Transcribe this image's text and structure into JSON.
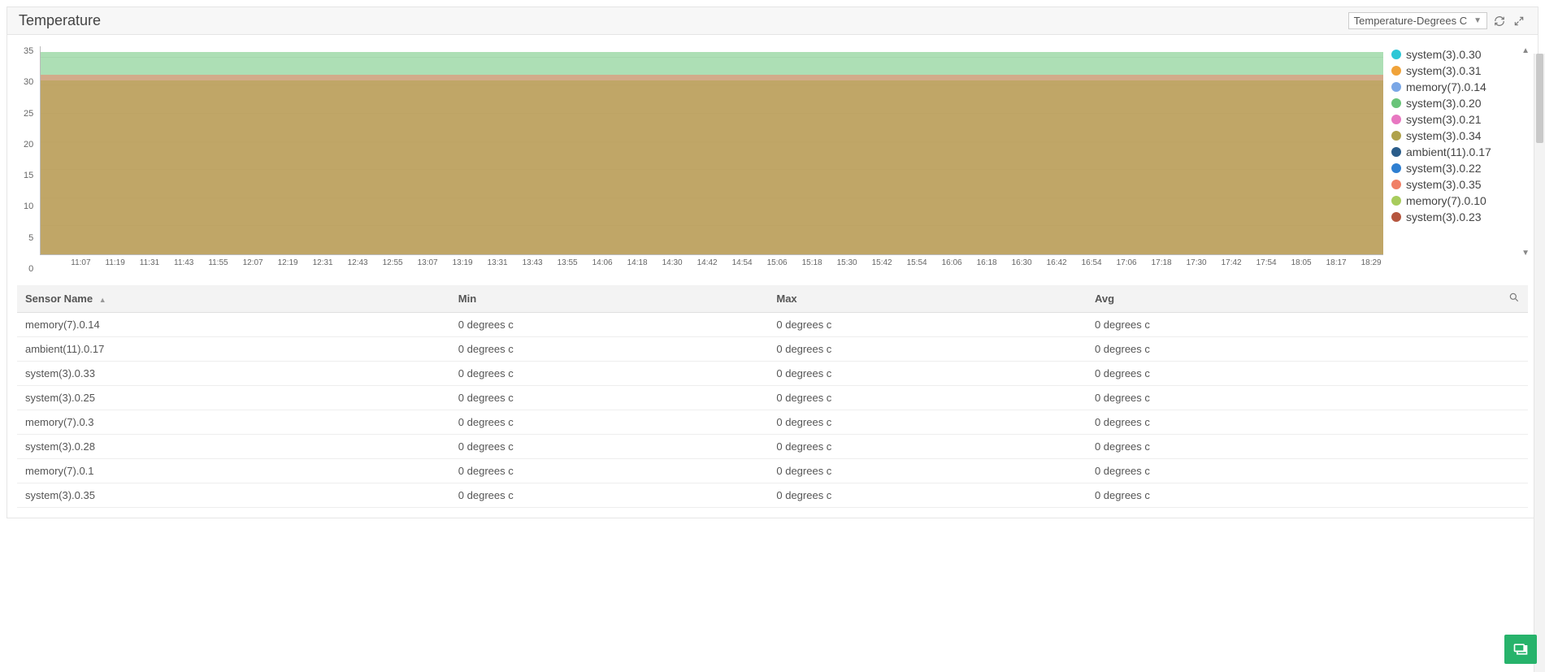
{
  "header": {
    "title": "Temperature",
    "dropdown_label": "Temperature-Degrees C"
  },
  "chart_data": {
    "type": "area",
    "ylabel": "",
    "xlabel": "",
    "ylim": [
      0,
      37
    ],
    "yticks": [
      0,
      5,
      10,
      15,
      20,
      25,
      30,
      35
    ],
    "xticks": [
      "11:07",
      "11:19",
      "11:31",
      "11:43",
      "11:55",
      "12:07",
      "12:19",
      "12:31",
      "12:43",
      "12:55",
      "13:07",
      "13:19",
      "13:31",
      "13:43",
      "13:55",
      "14:06",
      "14:18",
      "14:30",
      "14:42",
      "14:54",
      "15:06",
      "15:18",
      "15:30",
      "15:42",
      "15:54",
      "16:06",
      "16:18",
      "16:30",
      "16:42",
      "16:54",
      "17:06",
      "17:18",
      "17:30",
      "17:42",
      "17:54",
      "18:05",
      "18:17",
      "18:29"
    ],
    "series": [
      {
        "name": "system(3).0.30",
        "color": "#2ec7d6",
        "max": 0
      },
      {
        "name": "system(3).0.31",
        "color": "#f0a33a",
        "max": 0
      },
      {
        "name": "memory(7).0.14",
        "color": "#7aa7e6",
        "max": 0
      },
      {
        "name": "system(3).0.20",
        "color": "#69c479",
        "max": 36
      },
      {
        "name": "system(3).0.21",
        "color": "#e877c1",
        "max": 0
      },
      {
        "name": "system(3).0.34",
        "color": "#b0a24b",
        "max": 31
      },
      {
        "name": "ambient(11).0.17",
        "color": "#2b5d8a",
        "max": 0
      },
      {
        "name": "system(3).0.22",
        "color": "#2f7fd1",
        "max": 0
      },
      {
        "name": "system(3).0.35",
        "color": "#f08066",
        "max": 32
      },
      {
        "name": "memory(7).0.10",
        "color": "#a8cc5c",
        "max": 0
      },
      {
        "name": "system(3).0.23",
        "color": "#b5563f",
        "max": 0
      }
    ]
  },
  "table": {
    "columns": {
      "sensor": "Sensor Name",
      "min": "Min",
      "max": "Max",
      "avg": "Avg"
    },
    "rows": [
      {
        "sensor": "memory(7).0.14",
        "min": "0 degrees c",
        "max": "0 degrees c",
        "avg": "0 degrees c"
      },
      {
        "sensor": "ambient(11).0.17",
        "min": "0 degrees c",
        "max": "0 degrees c",
        "avg": "0 degrees c"
      },
      {
        "sensor": "system(3).0.33",
        "min": "0 degrees c",
        "max": "0 degrees c",
        "avg": "0 degrees c"
      },
      {
        "sensor": "system(3).0.25",
        "min": "0 degrees c",
        "max": "0 degrees c",
        "avg": "0 degrees c"
      },
      {
        "sensor": "memory(7).0.3",
        "min": "0 degrees c",
        "max": "0 degrees c",
        "avg": "0 degrees c"
      },
      {
        "sensor": "system(3).0.28",
        "min": "0 degrees c",
        "max": "0 degrees c",
        "avg": "0 degrees c"
      },
      {
        "sensor": "memory(7).0.1",
        "min": "0 degrees c",
        "max": "0 degrees c",
        "avg": "0 degrees c"
      },
      {
        "sensor": "system(3).0.35",
        "min": "0 degrees c",
        "max": "0 degrees c",
        "avg": "0 degrees c"
      }
    ]
  }
}
